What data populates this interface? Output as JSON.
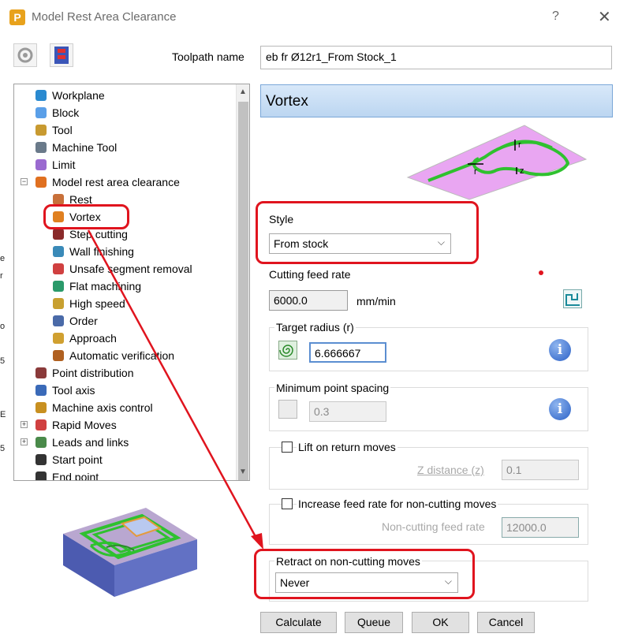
{
  "window": {
    "title": "Model Rest Area Clearance",
    "app_icon_letter": "P",
    "help_label": "?",
    "close_label": "✕"
  },
  "toolpath": {
    "label": "Toolpath name",
    "value": "eb fr Ø12r1_From Stock_1"
  },
  "tree": {
    "items": [
      {
        "label": "Workplane",
        "icon": "workplane-icon",
        "indent": 0,
        "expander": ""
      },
      {
        "label": "Block",
        "icon": "block-icon",
        "indent": 0,
        "expander": ""
      },
      {
        "label": "Tool",
        "icon": "tool-icon",
        "indent": 0,
        "expander": ""
      },
      {
        "label": "Machine Tool",
        "icon": "machine-tool-icon",
        "indent": 0,
        "expander": ""
      },
      {
        "label": "Limit",
        "icon": "limit-icon",
        "indent": 0,
        "expander": ""
      },
      {
        "label": "Model rest area clearance",
        "icon": "model-rest-icon",
        "indent": 0,
        "expander": "−"
      },
      {
        "label": "Rest",
        "icon": "rest-icon",
        "indent": 1,
        "expander": ""
      },
      {
        "label": "Vortex",
        "icon": "vortex-icon",
        "indent": 1,
        "expander": ""
      },
      {
        "label": "Step cutting",
        "icon": "step-cutting-icon",
        "indent": 1,
        "expander": ""
      },
      {
        "label": "Wall finishing",
        "icon": "wall-finishing-icon",
        "indent": 1,
        "expander": ""
      },
      {
        "label": "Unsafe segment removal",
        "icon": "unsafe-segment-icon",
        "indent": 1,
        "expander": ""
      },
      {
        "label": "Flat machining",
        "icon": "flat-machining-icon",
        "indent": 1,
        "expander": ""
      },
      {
        "label": "High speed",
        "icon": "high-speed-icon",
        "indent": 1,
        "expander": ""
      },
      {
        "label": "Order",
        "icon": "order-icon",
        "indent": 1,
        "expander": ""
      },
      {
        "label": "Approach",
        "icon": "approach-icon",
        "indent": 1,
        "expander": ""
      },
      {
        "label": "Automatic verification",
        "icon": "auto-verification-icon",
        "indent": 1,
        "expander": ""
      },
      {
        "label": "Point distribution",
        "icon": "point-distribution-icon",
        "indent": 0,
        "expander": ""
      },
      {
        "label": "Tool axis",
        "icon": "tool-axis-icon",
        "indent": 0,
        "expander": ""
      },
      {
        "label": "Machine axis control",
        "icon": "machine-axis-icon",
        "indent": 0,
        "expander": ""
      },
      {
        "label": "Rapid Moves",
        "icon": "rapid-moves-icon",
        "indent": 0,
        "expander": "+"
      },
      {
        "label": "Leads and links",
        "icon": "leads-links-icon",
        "indent": 0,
        "expander": "+"
      },
      {
        "label": "Start point",
        "icon": "start-point-icon",
        "indent": 0,
        "expander": ""
      },
      {
        "label": "End point",
        "icon": "end-point-icon",
        "indent": 0,
        "expander": ""
      }
    ],
    "selected": "Vortex"
  },
  "panel": {
    "header": "Vortex",
    "diagram_labels": {
      "r_top": "r",
      "r_left": "r",
      "z": "z"
    },
    "style": {
      "label": "Style",
      "value": "From stock"
    },
    "cutting_feed": {
      "label": "Cutting feed rate",
      "value": "6000.0",
      "unit": "mm/min"
    },
    "target_radius": {
      "label": "Target radius (r)",
      "value": "6.666667",
      "info": "i"
    },
    "min_point_spacing": {
      "label": "Minimum point spacing",
      "value": "0.3",
      "info": "i"
    },
    "lift": {
      "label": "Lift on return moves",
      "checked": false,
      "z_label": "Z distance (z)",
      "z_value": "0.1"
    },
    "increase_feed": {
      "label": "Increase feed rate for non-cutting moves",
      "checked": false,
      "rate_label": "Non-cutting feed rate",
      "rate_value": "12000.0"
    },
    "retract": {
      "label": "Retract on non-cutting moves",
      "value": "Never"
    }
  },
  "buttons": {
    "calculate": "Calculate",
    "queue": "Queue",
    "ok": "OK",
    "cancel": "Cancel"
  },
  "edge_marks": [
    "e",
    "r",
    "o",
    "5",
    "E",
    "5"
  ],
  "colors": {
    "highlight": "#e0141e",
    "toolpath_green": "#2fc12f",
    "stock_pink": "#e9a6f2",
    "block_blue": "#5a6ab8"
  }
}
